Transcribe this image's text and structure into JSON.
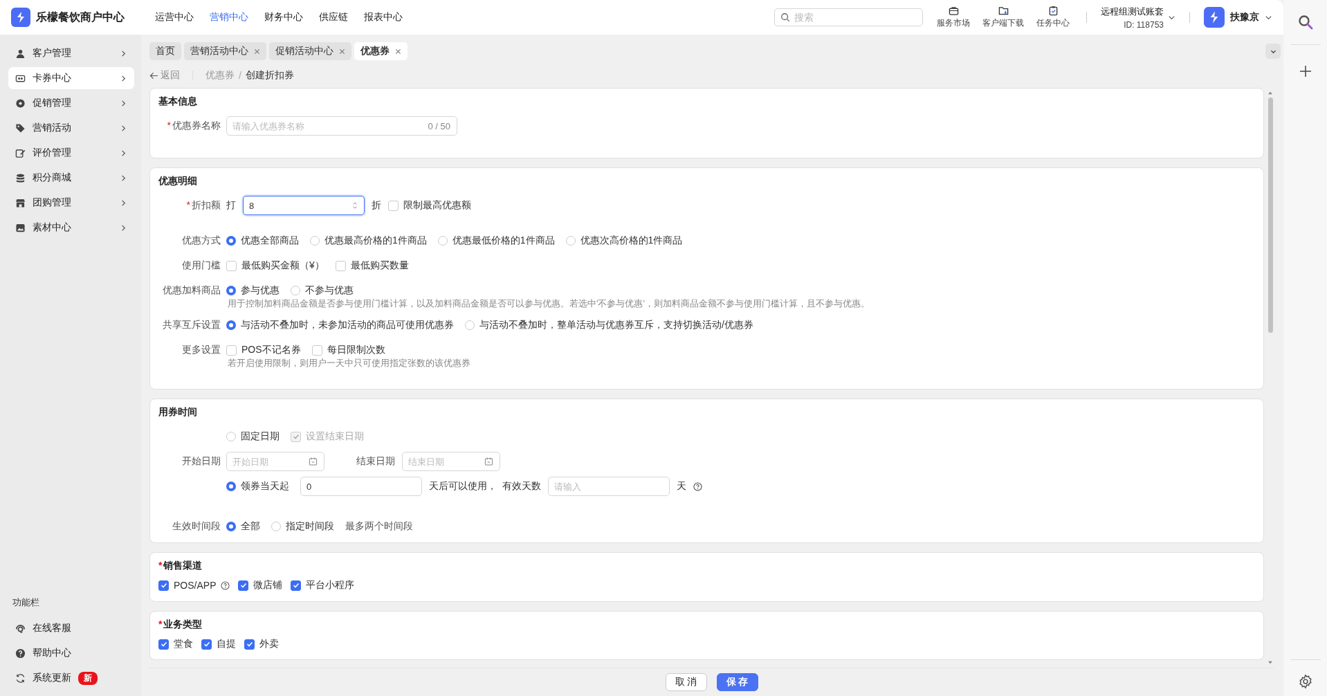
{
  "app": {
    "name": "乐檬餐饮商户中心"
  },
  "top_nav": [
    {
      "label": "运营中心",
      "selected": false
    },
    {
      "label": "营销中心",
      "selected": true
    },
    {
      "label": "财务中心",
      "selected": false
    },
    {
      "label": "供应链",
      "selected": false
    },
    {
      "label": "报表中心",
      "selected": false
    }
  ],
  "search": {
    "placeholder": "搜索"
  },
  "top_tools": [
    {
      "label": "服务市场"
    },
    {
      "label": "客户端下载"
    },
    {
      "label": "任务中心"
    }
  ],
  "account": {
    "name": "远程组测试账套",
    "id": "ID: 118753"
  },
  "user": {
    "name": "扶豫京"
  },
  "sidebar": {
    "items": [
      {
        "label": "客户管理",
        "selected": false
      },
      {
        "label": "卡券中心",
        "selected": true
      },
      {
        "label": "促销管理",
        "selected": false
      },
      {
        "label": "营销活动",
        "selected": false
      },
      {
        "label": "评价管理",
        "selected": false
      },
      {
        "label": "积分商城",
        "selected": false
      },
      {
        "label": "团购管理",
        "selected": false
      },
      {
        "label": "素材中心",
        "selected": false
      }
    ],
    "section_title": "功能栏",
    "tools": [
      {
        "label": "在线客服"
      },
      {
        "label": "帮助中心"
      },
      {
        "label": "系统更新",
        "badge": "新"
      }
    ]
  },
  "tabs": [
    {
      "label": "首页",
      "closable": false,
      "selected": false
    },
    {
      "label": "营销活动中心",
      "closable": true,
      "selected": false
    },
    {
      "label": "促销活动中心",
      "closable": true,
      "selected": false
    },
    {
      "label": "优惠券",
      "closable": true,
      "selected": true
    }
  ],
  "breadcrumb": {
    "back": "返回",
    "separator": "/",
    "items": [
      "优惠券",
      "创建折扣券"
    ]
  },
  "basic": {
    "title": "基本信息",
    "name_field": {
      "label": "优惠券名称",
      "required_mark": "*",
      "placeholder": "请输入优惠券名称",
      "count": "0 / 50"
    }
  },
  "discount": {
    "title": "优惠明细",
    "rate": {
      "label": "折扣额",
      "required_mark": "*",
      "prefix": "打",
      "value": "8",
      "suffix": "折",
      "cap": {
        "label": "限制最高优惠额",
        "checked": false
      }
    },
    "rows": [
      {
        "kind": "radio",
        "label": "优惠方式",
        "options": [
          {
            "label": "优惠全部商品",
            "selected": true
          },
          {
            "label": "优惠最高价格的1件商品",
            "selected": false
          },
          {
            "label": "优惠最低价格的1件商品",
            "selected": false
          },
          {
            "label": "优惠次高价格的1件商品",
            "selected": false
          }
        ]
      },
      {
        "kind": "checkbox",
        "label": "使用门槛",
        "options": [
          {
            "label": "最低购买金额（¥）",
            "checked": false
          },
          {
            "label": "最低购买数量",
            "checked": false
          }
        ]
      },
      {
        "kind": "radio",
        "label": "优惠加料商品",
        "options": [
          {
            "label": "参与优惠",
            "selected": true
          },
          {
            "label": "不参与优惠",
            "selected": false
          }
        ],
        "hint": "用于控制加料商品金额是否参与使用门槛计算，以及加料商品金额是否可以参与优惠。若选中'不参与优惠'，则加料商品金额不参与使用门槛计算，且不参与优惠。"
      },
      {
        "kind": "radio",
        "label": "共享互斥设置",
        "options": [
          {
            "label": "与活动不叠加时，未参加活动的商品可使用优惠券",
            "selected": true
          },
          {
            "label": "与活动不叠加时，整单活动与优惠券互斥，支持切换活动/优惠券",
            "selected": false
          }
        ]
      },
      {
        "kind": "checkbox",
        "label": "更多设置",
        "options": [
          {
            "label": "POS不记名券",
            "checked": false
          },
          {
            "label": "每日限制次数",
            "checked": false
          }
        ],
        "hint": "若开启使用限制，则用户一天中只可使用指定张数的该优惠券"
      }
    ]
  },
  "validity": {
    "title": "用券时间",
    "fixed": {
      "label": "固定日期",
      "selected": false,
      "end_option": {
        "label": "设置结束日期",
        "checked": true,
        "disabled": true
      }
    },
    "start": {
      "label": "开始日期",
      "placeholder": "开始日期"
    },
    "end": {
      "label": "结束日期",
      "placeholder": "结束日期"
    },
    "relative": {
      "label": "领券当天起",
      "selected": true,
      "value": "0",
      "middle": "天后可以使用，",
      "days_label": "有效天数",
      "days_placeholder": "请输入",
      "unit": "天"
    },
    "period": {
      "label": "生效时间段",
      "options": [
        {
          "label": "全部",
          "selected": true
        },
        {
          "label": "指定时间段",
          "selected": false
        }
      ],
      "note": "最多两个时间段"
    }
  },
  "channels": {
    "title": "销售渠道",
    "required_mark": "*",
    "options": [
      {
        "label": "POS/APP",
        "checked": true,
        "help": true
      },
      {
        "label": "微店铺",
        "checked": true
      },
      {
        "label": "平台小程序",
        "checked": true
      }
    ]
  },
  "business": {
    "title": "业务类型",
    "required_mark": "*",
    "options": [
      {
        "label": "堂食",
        "checked": true
      },
      {
        "label": "自提",
        "checked": true
      },
      {
        "label": "外卖",
        "checked": true
      }
    ]
  },
  "footer": {
    "cancel": "取 消",
    "save": "保 存"
  }
}
